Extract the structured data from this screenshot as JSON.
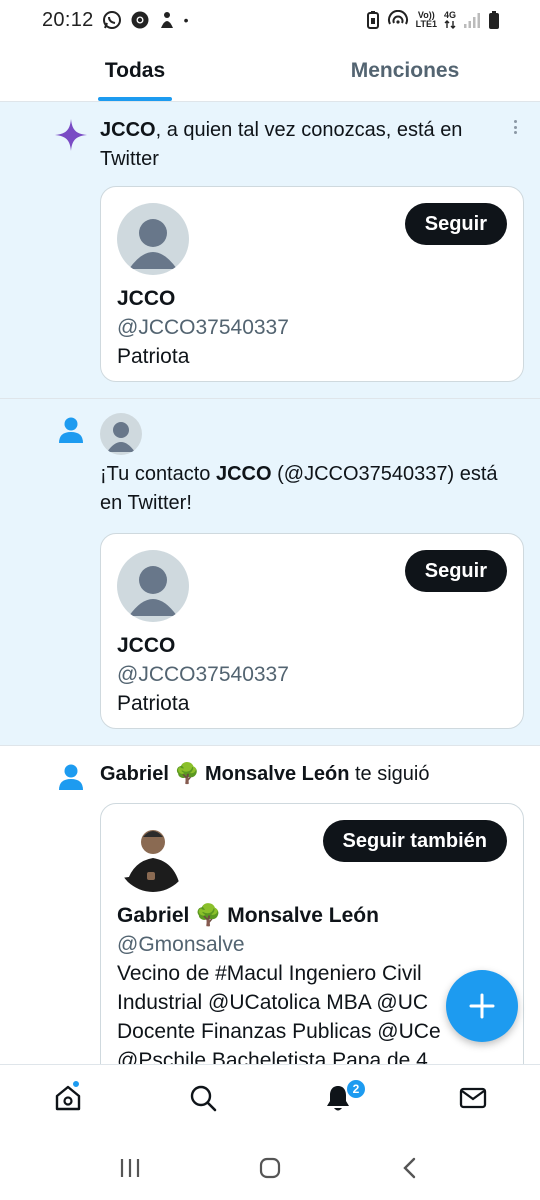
{
  "status_bar": {
    "time": "20:12",
    "left_icons": [
      "whatsapp-icon",
      "chrome-icon",
      "app-notification-icon"
    ],
    "dot": "•",
    "volte_top": "Vo))",
    "volte_bottom": "LTE1",
    "network": "4G"
  },
  "tabs": [
    {
      "label": "Todas",
      "active": true
    },
    {
      "label": "Menciones",
      "active": false
    }
  ],
  "notifications": [
    {
      "type": "suggestion",
      "icon": "sparkle-icon",
      "name": "JCCO",
      "text_after_name": ", a quien tal vez conozcas, está en Twitter",
      "card": {
        "name": "JCCO",
        "handle": "@JCCO37540337",
        "bio": "Patriota",
        "button": "Seguir"
      }
    },
    {
      "type": "contact",
      "icon": "person-icon",
      "text_before_name": "¡Tu contacto ",
      "name": "JCCO",
      "text_after_name": " (@JCCO37540337) está en Twitter!",
      "card": {
        "name": "JCCO",
        "handle": "@JCCO37540337",
        "bio": "Patriota",
        "button": "Seguir"
      }
    },
    {
      "type": "follow",
      "icon": "person-icon",
      "name_part1": "Gabriel",
      "emoji": "🌳",
      "name_part2": "Monsalve León",
      "text_after_name": " te siguió",
      "card": {
        "name_part1": "Gabriel",
        "emoji": "🌳",
        "name_part2": "Monsalve León",
        "handle": "@Gmonsalve",
        "bio_lines": [
          "Vecino de #Macul Ingeniero Civil",
          "Industrial @UCatolica MBA @UC",
          "Docente Finanzas Publicas @UCe",
          "@Pschile Bacheletista Papa de 4"
        ],
        "button": "Seguir también"
      }
    }
  ],
  "bottom_nav": {
    "notification_count": "2",
    "items": [
      "home-icon",
      "search-icon",
      "bell-icon",
      "mail-icon"
    ]
  },
  "colors": {
    "accent": "#1d9bf0",
    "highlight_bg": "#e8f5fd",
    "button_bg": "#0f1419",
    "secondary_text": "#536471",
    "sparkle": "#794bc4"
  }
}
